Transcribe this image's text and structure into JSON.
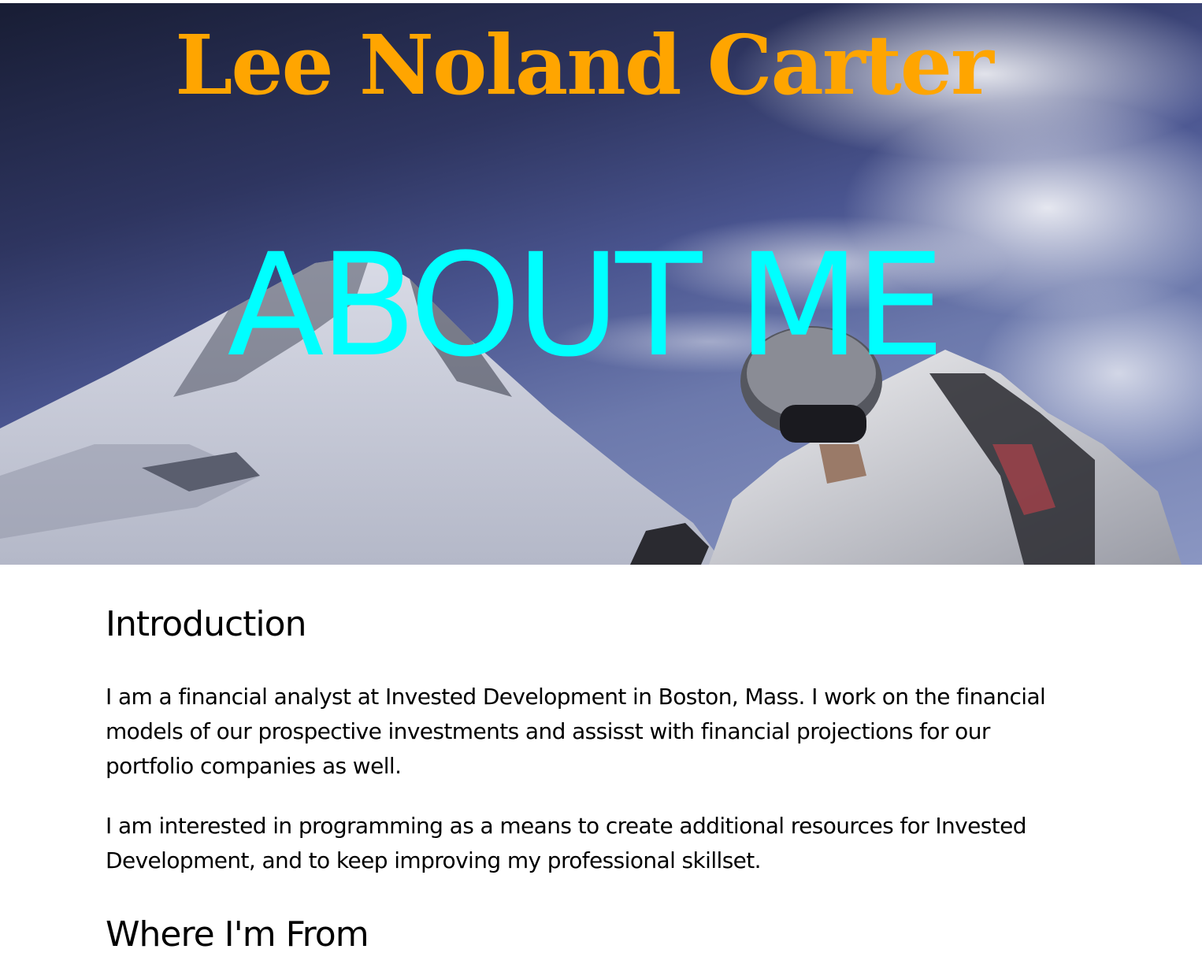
{
  "header": {
    "site_title": "Lee Noland Carter",
    "hero_heading": "ABOUT ME",
    "hero_image": "skier-on-snowy-mountain",
    "title_color": "#ffa500",
    "heading_color": "#00ffff"
  },
  "main": {
    "intro": {
      "title": "Introduction",
      "paragraphs": [
        "I am a financial analyst at Invested Development in Boston, Mass. I work on the financial models of our prospective investments and assisst with financial projections for our portfolio companies as well.",
        "I am interested in programming as a means to create additional resources for Invested Development, and to keep improving my professional skillset."
      ]
    },
    "from": {
      "title": "Where I'm From"
    }
  }
}
